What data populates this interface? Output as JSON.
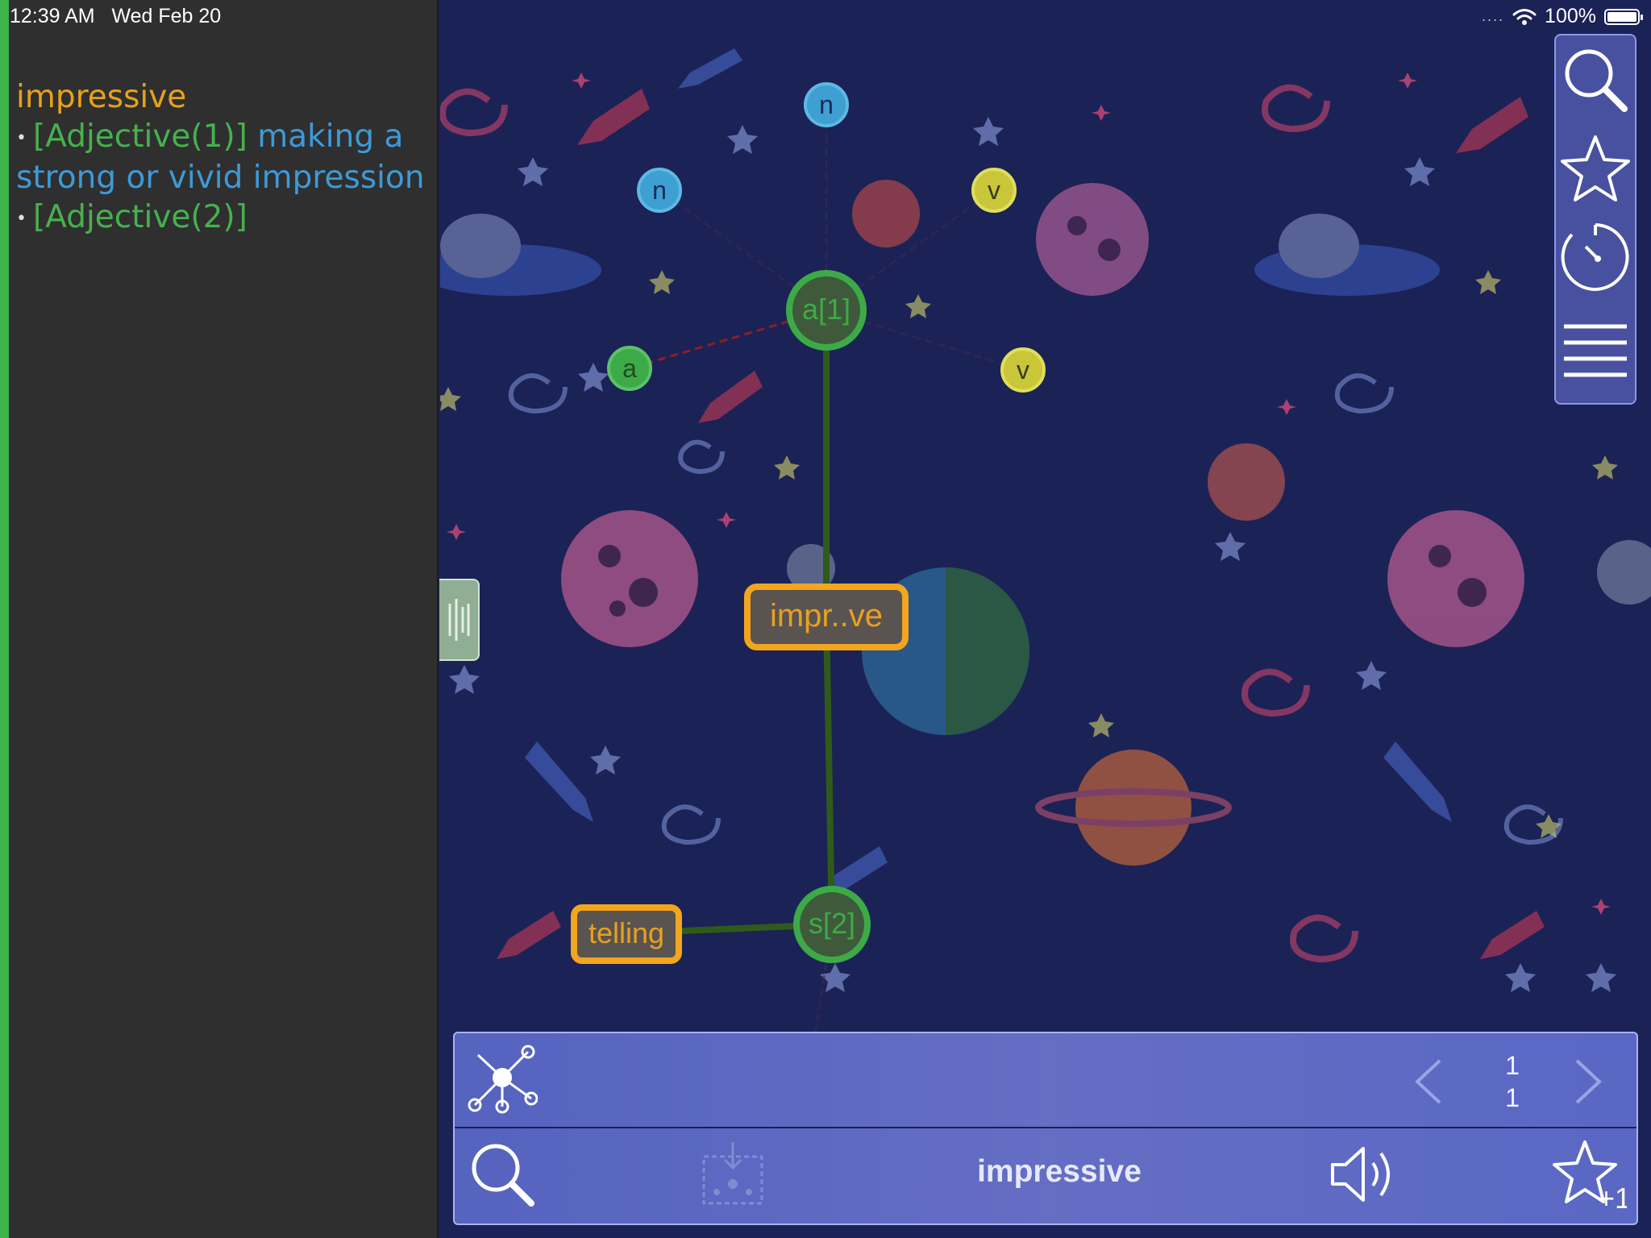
{
  "status_bar": {
    "time": "12:39 AM",
    "date": "Wed Feb 20",
    "signal_icon": "cellular-dots-icon",
    "wifi_icon": "wifi-icon",
    "battery_text": "100%",
    "battery_icon": "battery-icon",
    "battery_level": 1.0
  },
  "definition": {
    "headword": "impressive",
    "senses": [
      {
        "pos": "[Adjective(1)]",
        "gloss": "making a strong or vivid impression"
      },
      {
        "pos": "[Adjective(2)]",
        "gloss": ""
      }
    ]
  },
  "graph": {
    "nodes": {
      "n1": "n",
      "n2": "n",
      "v1": "v",
      "v2": "v",
      "a_small": "a",
      "a1": "a[1]",
      "center": "impr..ve",
      "s2": "s[2]",
      "telling": "telling"
    },
    "colors": {
      "noun": "#3d9fd2",
      "verb": "#c9c63a",
      "adjective": "#3daa48",
      "word_box": "#f2a51f",
      "edge": "#2f5a1a"
    }
  },
  "right_toolbar": {
    "search_icon": "search-icon",
    "favorites_icon": "star-icon",
    "history_icon": "timer-icon",
    "menu_icon": "menu-icon"
  },
  "bottom_panel": {
    "graph_mode_icon": "network-graph-icon",
    "prev_icon": "chevron-left-icon",
    "next_icon": "chevron-right-icon",
    "page_current": "1",
    "page_total": "1",
    "search_icon": "search-icon",
    "import_icon": "graph-import-icon",
    "word": "impressive",
    "speaker_icon": "speaker-icon",
    "add_favorite_icon": "star-plus-icon"
  },
  "side_handle_icon": "drag-handle-icon"
}
